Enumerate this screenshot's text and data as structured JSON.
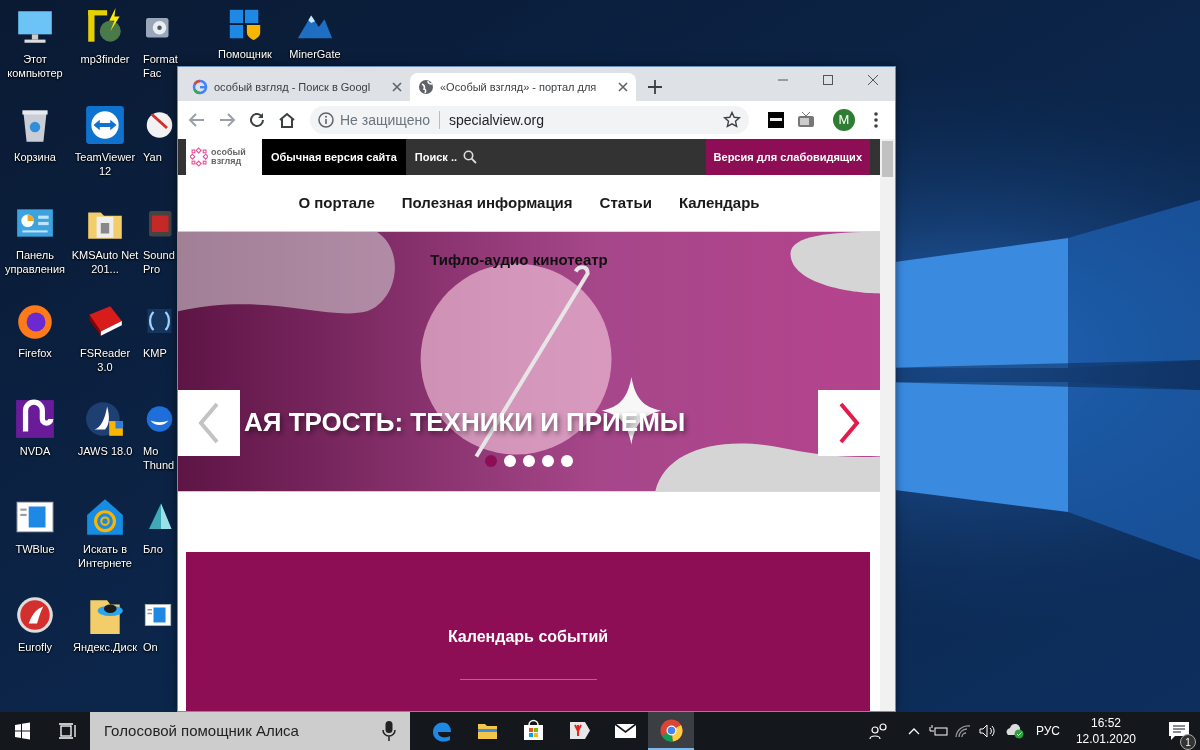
{
  "desktop": {
    "columns": [
      {
        "icons": [
          {
            "label": "Этот компьютер",
            "kind": "computer"
          },
          {
            "label": "Корзина",
            "kind": "bin"
          },
          {
            "label": "Панель управления",
            "kind": "panel"
          },
          {
            "label": "Firefox",
            "kind": "firefox"
          },
          {
            "label": "NVDA",
            "kind": "nvda"
          },
          {
            "label": "TWBlue",
            "kind": "window"
          },
          {
            "label": "Eurofly",
            "kind": "eurofly"
          }
        ]
      },
      {
        "icons": [
          {
            "label": "mp3finder",
            "kind": "mp3"
          },
          {
            "label": "TeamViewer 12",
            "kind": "teamviewer"
          },
          {
            "label": "KMSAuto Net 201...",
            "kind": "folder"
          },
          {
            "label": "FSReader 3.0",
            "kind": "book"
          },
          {
            "label": "JAWS 18.0",
            "kind": "jaws"
          },
          {
            "label": "Искать в Интернете",
            "kind": "house"
          },
          {
            "label": "Яндекс.Диск",
            "kind": "disk"
          }
        ]
      },
      {
        "icons": [
          {
            "label": "Format Fac",
            "kind": "reel"
          },
          {
            "label": "Yan",
            "kind": "ybrowser"
          },
          {
            "label": "Sound Pro",
            "kind": "sound"
          },
          {
            "label": "KMP",
            "kind": "kmp"
          },
          {
            "label": "Mo Thund",
            "kind": "bird"
          },
          {
            "label": "Бло",
            "kind": "prism"
          },
          {
            "label": "On",
            "kind": "window"
          }
        ]
      },
      {
        "icons": [
          {
            "label": "Помощник",
            "kind": "tiles"
          }
        ]
      },
      {
        "icons": [
          {
            "label": "MinerGate",
            "kind": "mountain"
          }
        ]
      }
    ]
  },
  "browser": {
    "tabs": [
      {
        "title": "особый взгляд - Поиск в Googl",
        "kind": "google",
        "selected": false
      },
      {
        "title": "«Особый взгляд» - портал для",
        "kind": "globe",
        "selected": true
      }
    ],
    "address_bar": {
      "security": "Не защищено",
      "url": "specialview.org"
    },
    "profile_initial": "M",
    "page": {
      "header": {
        "logo_text": "особый взгляд",
        "normal_version": "Обычная версия сайта",
        "search_label": "Поиск ..",
        "accessible_version": "Версия для слабовидящих"
      },
      "nav": [
        "О портале",
        "Полезная информация",
        "Статьи",
        "Календарь"
      ],
      "slider": {
        "caption": "Тифло-аудио кинотеатр",
        "headline": "АЯ ТРОСТЬ: ТЕХНИКИ И ПРИЕМЫ",
        "dots": [
          {
            "selected": true
          },
          {
            "selected": false
          },
          {
            "selected": false
          },
          {
            "selected": false
          },
          {
            "selected": false
          }
        ]
      },
      "calendar": {
        "title": "Календарь событий"
      }
    }
  },
  "taskbar": {
    "search_placeholder": "Голосовой помощник Алиса",
    "apps": [
      {
        "kind": "edge",
        "selected": false
      },
      {
        "kind": "explorer",
        "selected": false
      },
      {
        "kind": "store",
        "selected": false
      },
      {
        "kind": "yandex",
        "selected": false
      },
      {
        "kind": "mail",
        "selected": false
      },
      {
        "kind": "chrome",
        "selected": true
      }
    ],
    "language": "РУС",
    "time": "16:52",
    "date": "12.01.2020",
    "notification_count": "1"
  }
}
